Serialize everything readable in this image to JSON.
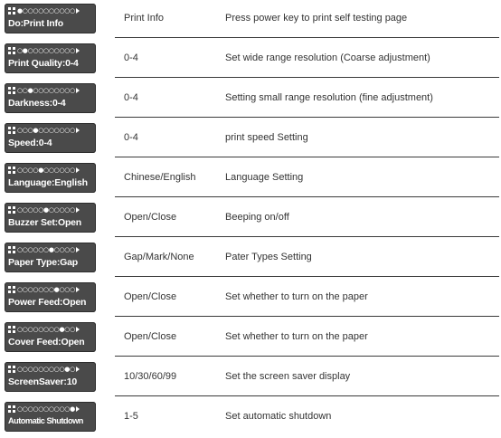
{
  "rows": [
    {
      "dots": "●○○○○○○○○○○",
      "label": "Do:Print Info",
      "setting": "Print Info",
      "description": "Press power key to print self testing page"
    },
    {
      "dots": "○●○○○○○○○○○",
      "label": "Print Quality:0-4",
      "setting": "0-4",
      "description": "Set wide range resolution (Coarse adjustment)"
    },
    {
      "dots": "○○●○○○○○○○○",
      "label": "Darkness:0-4",
      "setting": "0-4",
      "description": "Setting small range resolution (fine adjustment)"
    },
    {
      "dots": "○○○●○○○○○○○",
      "label": "Speed:0-4",
      "setting": "0-4",
      "description": "print speed Setting"
    },
    {
      "dots": "○○○○●○○○○○○",
      "label": "Language:English",
      "setting": "Chinese/English",
      "description": "Language Setting"
    },
    {
      "dots": "○○○○○●○○○○○",
      "label": "Buzzer Set:Open",
      "setting": "Open/Close",
      "description": "Beeping on/off"
    },
    {
      "dots": "○○○○○○●○○○○",
      "label": "Paper Type:Gap",
      "setting": "Gap/Mark/None",
      "description": "Pater Types Setting"
    },
    {
      "dots": "○○○○○○○●○○○",
      "label": "Power Feed:Open",
      "setting": "Open/Close",
      "description": "Set whether to turn on the paper"
    },
    {
      "dots": "○○○○○○○○●○○",
      "label": "Cover Feed:Open",
      "setting": "Open/Close",
      "description": "Set whether to turn on the paper"
    },
    {
      "dots": "○○○○○○○○○●○",
      "label": "ScreenSaver:10",
      "setting": "10/30/60/99",
      "description": "Set the screen saver display"
    },
    {
      "dots": "○○○○○○○○○○●",
      "label": "Automatic Shutdown",
      "setting": "1-5",
      "description": "Set automatic shutdown"
    }
  ],
  "colors": {
    "lcd_background": "#4a4a4a",
    "text": "#333333",
    "divider": "#3a3a3a"
  }
}
